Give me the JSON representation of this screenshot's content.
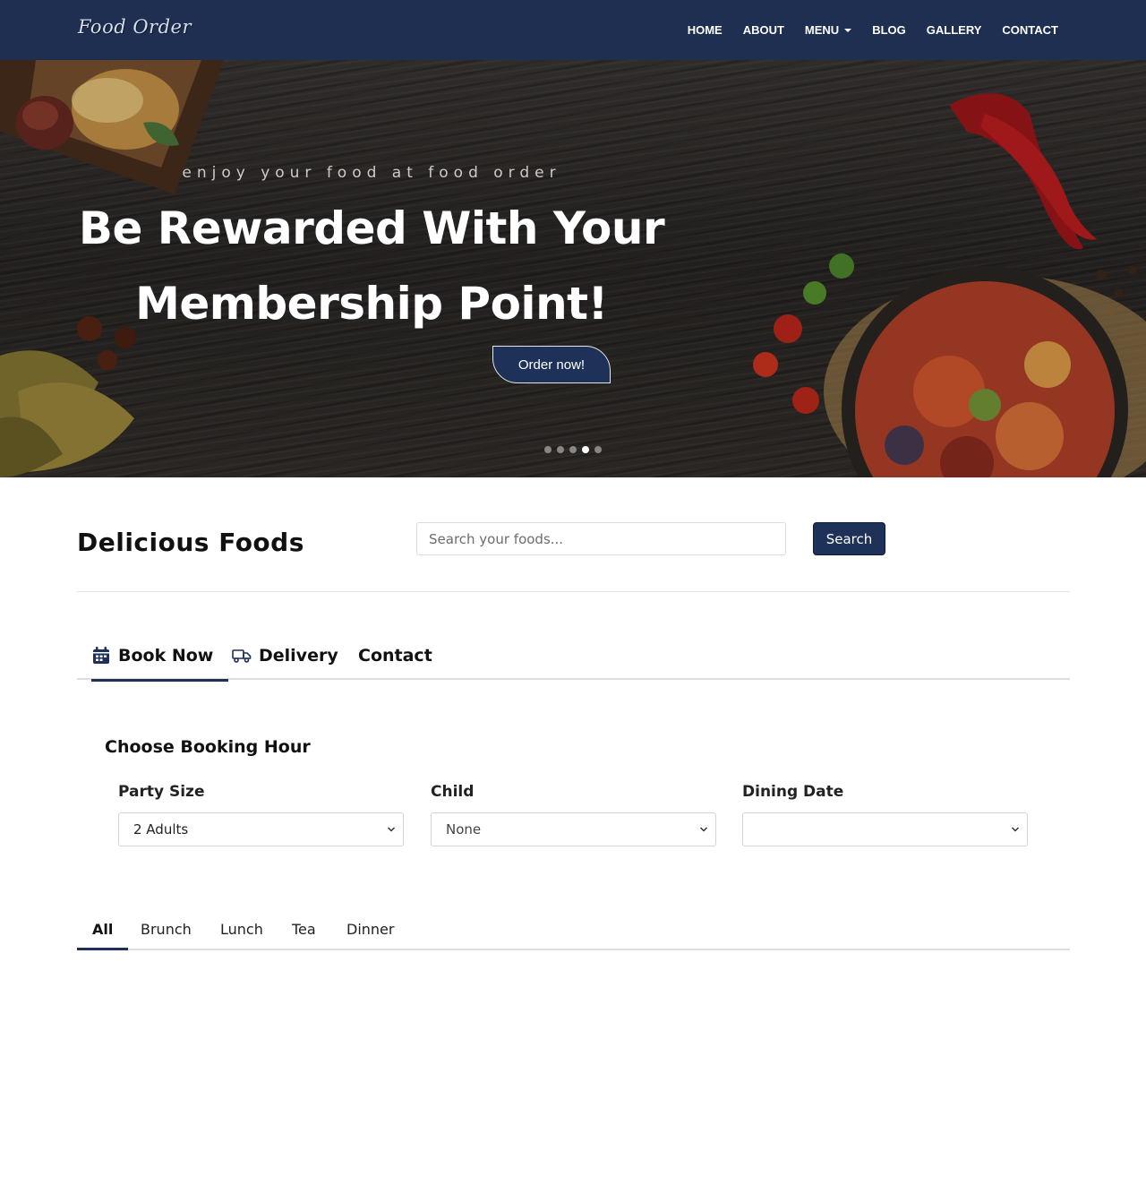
{
  "navbar": {
    "brand": "Food Order",
    "links": [
      "HOME",
      "ABOUT",
      "MENU",
      "BLOG",
      "GALLERY",
      "CONTACT"
    ]
  },
  "hero": {
    "subtitle": "enjoy your food at food order",
    "title_line1": "Be Rewarded With Your",
    "title_line2": "Membership Point!",
    "cta": "Order now!",
    "carousel": {
      "slides": 5,
      "active_index": 3
    }
  },
  "search": {
    "heading": "Delicious Foods",
    "placeholder": "Search your foods...",
    "button": "Search"
  },
  "main_tabs": {
    "items": [
      "Book Now",
      "Delivery",
      "Contact"
    ],
    "active": "Book Now",
    "icons": [
      "calendar-icon",
      "truck-icon"
    ]
  },
  "booking": {
    "title": "Choose Booking Hour",
    "party_size": {
      "label": "Party Size",
      "value": "2 Adults"
    },
    "child": {
      "label": "Child",
      "value": "None"
    },
    "dining_date": {
      "label": "Dining Date",
      "value": ""
    }
  },
  "meal_tabs": {
    "items": [
      "All",
      "Brunch",
      "Lunch",
      "Tea",
      "Dinner"
    ],
    "active": "All"
  },
  "colors": {
    "navy": "#1e2f52",
    "button": "#1e3158",
    "white": "#ffffff"
  }
}
